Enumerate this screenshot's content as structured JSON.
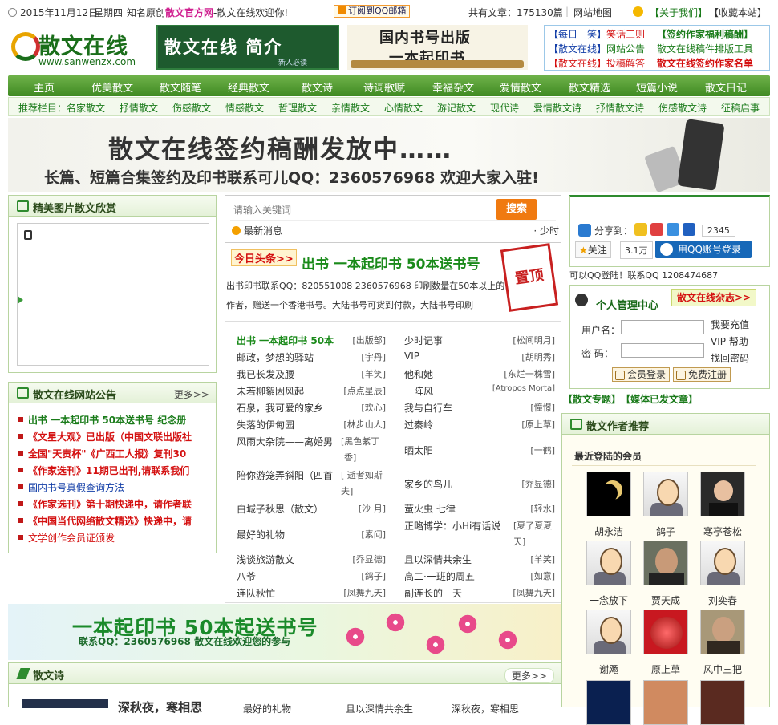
{
  "topbar": {
    "date": "2015年11月12日",
    "weekday": "星期四",
    "tag_pre": "知名原创",
    "tag_brand": "散文官方网",
    "tag_post": "-散文在线欢迎你!",
    "qqmail": "订阅到QQ邮箱",
    "total": "共有文章：175130篇",
    "sitemap": "网站地图",
    "about": "【关于我们】",
    "bookmark": "【收藏本站】"
  },
  "logo": {
    "name": "散文在线",
    "url": "www.sanwenzx.com"
  },
  "banner1": {
    "text": "散文在线 简介",
    "sub": "新人必读"
  },
  "banner2": {
    "line1": "国内书号出版",
    "line2": "一本起印书"
  },
  "quicklinks": [
    {
      "a": "【每日一笑】",
      "b": "笑话三则",
      "c": "【签约作家福利稿酬】"
    },
    {
      "a": "【散文在线】",
      "b": "网站公告",
      "c": "散文在线稿件排版工具"
    },
    {
      "a": "【散文在线】",
      "b": "投稿解答",
      "c": "散文在线签约作家名单"
    }
  ],
  "nav": [
    "主页",
    "优美散文",
    "散文随笔",
    "经典散文",
    "散文诗",
    "诗词歌赋",
    "幸福杂文",
    "爱情散文",
    "散文精选",
    "短篇小说",
    "散文日记"
  ],
  "subnav": {
    "label": "推荐栏目：",
    "items": [
      "名家散文",
      "抒情散文",
      "伤感散文",
      "情感散文",
      "哲理散文",
      "亲情散文",
      "心情散文",
      "游记散文",
      "现代诗",
      "爱情散文诗",
      "抒情散文诗",
      "伤感散文诗",
      "征稿启事"
    ]
  },
  "adbanner": {
    "line1": "散文在线签约稿酬发放中……",
    "line2": "长篇、短篇合集签约及印书联系可儿QQ：2360576968 欢迎大家入驻!"
  },
  "gallery": {
    "title": "精美图片散文欣赏"
  },
  "notice": {
    "title": "散文在线网站公告",
    "more": "更多>>",
    "items": [
      {
        "text": "出书 一本起印书 50本送书号 纪念册",
        "color": "green"
      },
      {
        "text": "《文星大观》已出版（中国文联出版社",
        "color": "red"
      },
      {
        "text": "全国\"天责杯\"《广西工人报》复刊30",
        "color": "red"
      },
      {
        "text": "《作家选刊》11期已出刊,请联系我们",
        "color": "red"
      },
      {
        "text": "国内书号真假查询方法",
        "color": "blue"
      },
      {
        "text": "《作家选刊》第十期快递中，请作者联",
        "color": "red"
      },
      {
        "text": "《中国当代网络散文精选》快递中，请",
        "color": "red"
      },
      {
        "text": "文学创作会员证颁发",
        "color": "red"
      }
    ]
  },
  "search": {
    "placeholder": "请输入关键词",
    "button": "搜索",
    "news": "最新消息",
    "news_right": "· 少时"
  },
  "headline": {
    "badge": "今日头条",
    "title": "出书 一本起印书 50本送书号",
    "desc1": "出书印书联系QQ：820551008 2360576968 印刷数量在50本以上的",
    "desc2": "作者，赠送一个香港书号。大陆书号可货到付款，大陆书号印刷",
    "stamp": "置顶"
  },
  "articles_left": [
    {
      "t": "出书 一本起印书 50本",
      "a": "[出版部]",
      "hl": true
    },
    {
      "t": "邮政，梦想的驿站",
      "a": "[宇丹]"
    },
    {
      "t": "我已长发及腰",
      "a": "[羊笑]"
    },
    {
      "t": "未若柳絮因风起",
      "a": "[点点星辰]"
    },
    {
      "t": "石泉，我可爱的家乡",
      "a": "[欢心]"
    },
    {
      "t": "失落的伊甸园",
      "a": "[林步山人]"
    },
    {
      "t": "风雨大杂院——离婚男",
      "a": "[黑色紫丁",
      "a2": "香]"
    },
    {
      "t": "陪你游笼弄斜阳（四首",
      "a": "[ 逝者如斯",
      "a2": "夫]"
    },
    {
      "t": "白城子秋思（散文）",
      "a": "[沙 月]"
    },
    {
      "t": "最好的礼物",
      "a": "[素问]"
    },
    {
      "t": "浅谈旅游散文",
      "a": "[乔显德]"
    },
    {
      "t": "八爷",
      "a": "[鸽子]"
    },
    {
      "t": "连队秋忙",
      "a": "[凤舞九天]"
    }
  ],
  "articles_right": [
    {
      "t": "少时记事",
      "a": "[松间明月]"
    },
    {
      "t": "VIP",
      "a": "[胡明秀]"
    },
    {
      "t": "他和她",
      "a": "[东烂一株雪]"
    },
    {
      "t": "一阵风",
      "a": "[Atropos Morta]"
    },
    {
      "t": "我与自行车",
      "a": "[憧憬]"
    },
    {
      "t": "过秦岭",
      "a": "[原上草]"
    },
    {
      "t": "晒太阳",
      "a": "[一鹤]"
    },
    {
      "t": "家乡的鸟儿",
      "a": "[乔显德]"
    },
    {
      "t": "萤火虫 七律",
      "a": "[轻水]"
    },
    {
      "t": "正略博学：小Hi有话说",
      "a": "[夏了夏夏",
      "a2": "天]"
    },
    {
      "t": "且以深情共余生",
      "a": "[羊笑]"
    },
    {
      "t": "高二·一班的周五",
      "a": "[如意]"
    },
    {
      "t": "副连长的一天",
      "a": "[凤舞九天]"
    }
  ],
  "adbanner2": {
    "line1": "一本起印书 50本起送书号",
    "line2": "联系QQ：2360576968 散文在线欢迎您的参与"
  },
  "share": {
    "label": "分享到：",
    "count": "2345",
    "follow": "关注",
    "follow_count": "3.1万",
    "qq_login": "用QQ账号登录"
  },
  "qq_contact": "可以QQ登陆！联系QQ 1208474687",
  "member": {
    "title": "个人管理中心",
    "tag": "散文在线杂志>>",
    "user_label": "用户名：",
    "pass_label": "密  码：",
    "link1": "我要充值",
    "link2": "VIP 帮助",
    "link3": "找回密码",
    "login": "会员登录",
    "register": "免费注册"
  },
  "special": {
    "a": "【散文专题】",
    "b": "【媒体已发文章】"
  },
  "authors": {
    "title": "散文作者推荐",
    "recent": "最近登陆的会员",
    "people": [
      "胡永洁",
      "鸽子",
      "寒亭苍松",
      "一念放下",
      "贾天成",
      "刘奕春",
      "谢飏",
      "原上草",
      "风中三把"
    ]
  },
  "poem": {
    "title": "散文诗",
    "more": "更多>>",
    "items": [
      "深秋夜，寒相思",
      "最好的礼物",
      "且以深情共余生",
      "深秋夜，寒相思"
    ]
  }
}
